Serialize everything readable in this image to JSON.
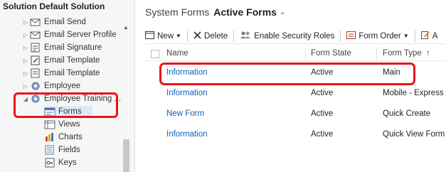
{
  "solution": {
    "title": "Solution Default Solution",
    "tree": [
      {
        "label": "Email Send",
        "icon": "email-icon"
      },
      {
        "label": "Email Server Profile",
        "icon": "email-server-icon"
      },
      {
        "label": "Email Signature",
        "icon": "email-signature-icon"
      },
      {
        "label": "Email Template",
        "icon": "email-template-icon"
      },
      {
        "label": "Email Template",
        "icon": "email-template-icon"
      },
      {
        "label": "Employee",
        "icon": "entity-icon"
      },
      {
        "label": "Employee Training ...",
        "icon": "entity-gear-icon"
      }
    ],
    "children": [
      {
        "label": "Forms",
        "icon": "form-icon"
      },
      {
        "label": "Views",
        "icon": "view-icon"
      },
      {
        "label": "Charts",
        "icon": "chart-icon"
      },
      {
        "label": "Fields",
        "icon": "field-icon"
      },
      {
        "label": "Keys",
        "icon": "key-icon"
      }
    ]
  },
  "header": {
    "system_label": "System Forms",
    "view_label": "Active Forms",
    "caret": "⌄"
  },
  "toolbar": {
    "new_label": "New",
    "delete_label": "Delete",
    "security_label": "Enable Security Roles",
    "form_order_label": "Form Order",
    "more_label": "A"
  },
  "grid": {
    "columns": {
      "name": "Name",
      "state": "Form State",
      "type": "Form Type",
      "sort_arrow": "↑"
    },
    "rows": [
      {
        "name": "Information",
        "state": "Active",
        "type": "Main"
      },
      {
        "name": "Information",
        "state": "Active",
        "type": "Mobile - Express"
      },
      {
        "name": "New Form",
        "state": "Active",
        "type": "Quick Create"
      },
      {
        "name": "Information",
        "state": "Active",
        "type": "Quick View Form"
      }
    ]
  },
  "colors": {
    "link": "#1160b7",
    "highlight": "#e8121c",
    "selection": "#dfe9f5"
  }
}
